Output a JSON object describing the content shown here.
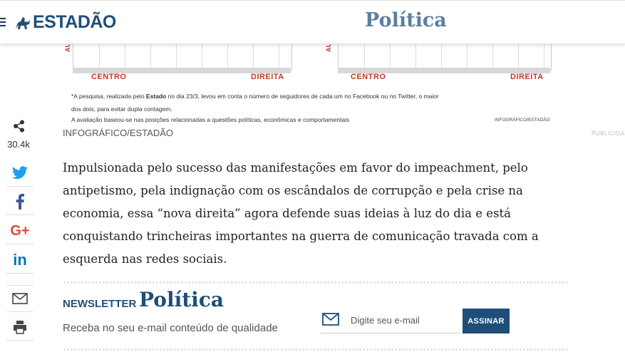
{
  "header": {
    "logo_text": "ESTADÃO",
    "section_title": "Política"
  },
  "infographic": {
    "axis_left_label": "CENTRO",
    "axis_right_label": "DIREITA",
    "vertical_label": "AU",
    "note_line1_pre": "*A pesquisa, realizada pelo ",
    "note_line1_bold": "Estado",
    "note_line1_post": " no dia 23/3, levou em conta o número de seguidores de cada um no Facebook ou no Twitter, o maior",
    "note_line2": "dos dois, para evitar dupla contagem.",
    "note_line3": "A avaliação baseou-se nas posições relacionadas a questões políticas, econômicas e comportamentais",
    "credit_small": "INFOGRÁFICO/ESTADÃO",
    "credit": "INFOGRÁFICO/ESTADÃO"
  },
  "publicidade": "PUBLICIDA",
  "share": {
    "count": "30.4k",
    "buttons": [
      {
        "name": "twitter",
        "color": "#1da1f2"
      },
      {
        "name": "facebook",
        "color": "#3b5998"
      },
      {
        "name": "google-plus",
        "color": "#dd4b39"
      },
      {
        "name": "linkedin",
        "color": "#0077b5"
      },
      {
        "name": "email",
        "color": "#444444"
      },
      {
        "name": "print",
        "color": "#444444"
      }
    ]
  },
  "article": {
    "paragraph": "Impulsionada pelo sucesso das manifestações em favor do impeachment, pelo antipetismo, pela indignação com os escândalos de corrupção e pela crise na economia, essa “nova direita” agora defende suas ideias à luz do dia e está conquistando trincheiras importantes na guerra de comunicação travada com a esquerda nas redes sociais."
  },
  "newsletter": {
    "label": "NEWSLETTER",
    "title": "Política",
    "subtitle": "Receba no seu e-mail conteúdo de qualidade",
    "email_placeholder": "Digite seu e-mail",
    "email_value": "",
    "submit_label": "ASSINAR"
  },
  "colors": {
    "brand": "#1f4e79",
    "section": "#5b7fa0",
    "axis_red": "#c0392b"
  }
}
